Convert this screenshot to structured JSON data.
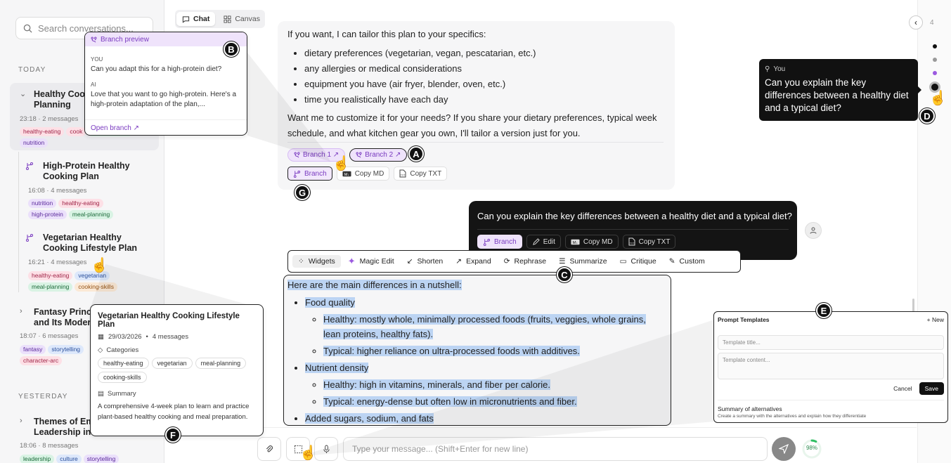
{
  "sidebar": {
    "search_placeholder": "Search conversations...",
    "today_label": "TODAY",
    "yesterday_label": "YESTERDAY",
    "conversations": [
      {
        "title": "Healthy Cooking Planning",
        "title_line1": "Healthy Cook",
        "title_line2": "Planning",
        "meta": "23:18 · 2 messages",
        "tags": [
          "healthy-eating",
          "cook",
          "meal-planning",
          "nutrition"
        ]
      },
      {
        "title_line1": "High-Protein Healthy",
        "title_line2": "Cooking Plan",
        "meta": "16:08 · 4 messages",
        "tags": [
          "nutrition",
          "healthy-eating",
          "high-protein",
          "meal-planning"
        ]
      },
      {
        "title_line1": "Vegetarian Healthy",
        "title_line2": "Cooking Lifestyle Plan",
        "meta": "16:21 · 4 messages",
        "tags": [
          "healthy-eating",
          "vegetarian",
          "meal-planning",
          "cooking-skills"
        ]
      },
      {
        "title_line1": "Fantasy Prince",
        "title_line2": "and Its Modern",
        "meta": "18:07 · 6 messages",
        "tags": [
          "fantasy",
          "storytelling",
          "character-arc"
        ]
      },
      {
        "title_line1": "Themes of Emp",
        "title_line2": "Leadership in S",
        "meta": "18:06 · 8 messages",
        "tags": [
          "leadership",
          "culture",
          "storytelling"
        ]
      }
    ]
  },
  "tabs": [
    {
      "label": "Chat",
      "active": true
    },
    {
      "label": "Canvas",
      "active": false
    }
  ],
  "message1": {
    "intro": "If you want, I can tailor this plan to your specifics:",
    "bullets": [
      "dietary preferences (vegetarian, vegan, pescatarian, etc.)",
      "any allergies or medical considerations",
      "equipment you have (air fryer, blender, oven, etc.)",
      "time you realistically have each day"
    ],
    "outro": "Want me to customize it for your needs? If you share your dietary preferences, typical week schedule, and what kitchen gear you own, I'll tailor a version just for you.",
    "branch_pills": [
      "Branch 1 ↗",
      "Branch 2 ↗"
    ],
    "actions": {
      "branch": "Branch",
      "copy_md": "Copy MD",
      "copy_txt": "Copy TXT"
    }
  },
  "user_message": {
    "text": "Can you explain the key differences between a healthy diet and a typical diet?",
    "actions": {
      "branch": "Branch",
      "edit": "Edit",
      "copy_md": "Copy MD",
      "copy_txt": "Copy TXT"
    }
  },
  "toolbar": [
    "Widgets",
    "Magic Edit",
    "Shorten",
    "Expand",
    "Rephrase",
    "Summarize",
    "Critique",
    "Custom"
  ],
  "message2": {
    "intro": "Here are the main differences in a nutshell:",
    "sections": [
      {
        "title": "Food quality",
        "items": [
          "Healthy: mostly whole, minimally processed foods (fruits, veggies, whole grains, lean proteins, healthy fats).",
          "Typical: higher reliance on ultra-processed foods with additives."
        ]
      },
      {
        "title": "Nutrient density",
        "items": [
          "Healthy: high in vitamins, minerals, and fiber per calorie.",
          "Typical: energy-dense but often low in micronutrients and fiber."
        ]
      },
      {
        "title": "Added sugars, sodium, and fats",
        "items": []
      }
    ]
  },
  "input": {
    "placeholder": "Type your message... (Shift+Enter for new line)",
    "progress_percent": 98,
    "progress_label": "98%"
  },
  "branch_preview": {
    "header": "Branch preview",
    "you_label": "YOU",
    "you_text": "Can you adapt this for a high-protein diet?",
    "ai_label": "AI",
    "ai_text": "Love that you want to go high-protein. Here's a high-protein adaptation of the plan,...",
    "open_label": "Open branch ↗"
  },
  "hover_card": {
    "title": "Vegetarian Healthy Cooking Lifestyle Plan",
    "date": "29/03/2026",
    "count": "4 messages",
    "categories_label": "Categories",
    "categories": [
      "healthy-eating",
      "vegetarian",
      "meal-planning",
      "cooking-skills"
    ],
    "summary_label": "Summary",
    "summary": "A comprehensive 4-week plan to learn and practice plant-based healthy cooking and meal preparation."
  },
  "nav_tooltip": {
    "label": "You",
    "text": "Can you explain the key differences between a healthy diet and a typical diet?"
  },
  "rail": {
    "count": "4",
    "dot_colors": [
      "#111111",
      "#999999",
      "#9b59e0",
      "#111111"
    ]
  },
  "templates": {
    "title": "Prompt Templates",
    "new_label": "New",
    "title_placeholder": "Template title...",
    "content_placeholder": "Template content...",
    "cancel": "Cancel",
    "save": "Save",
    "item_title": "Summary of alternatives",
    "item_desc": "Create a summary with the alternatives and explain how they differentiate"
  },
  "annotations": [
    "A",
    "B",
    "C",
    "D",
    "E",
    "F",
    "G"
  ]
}
